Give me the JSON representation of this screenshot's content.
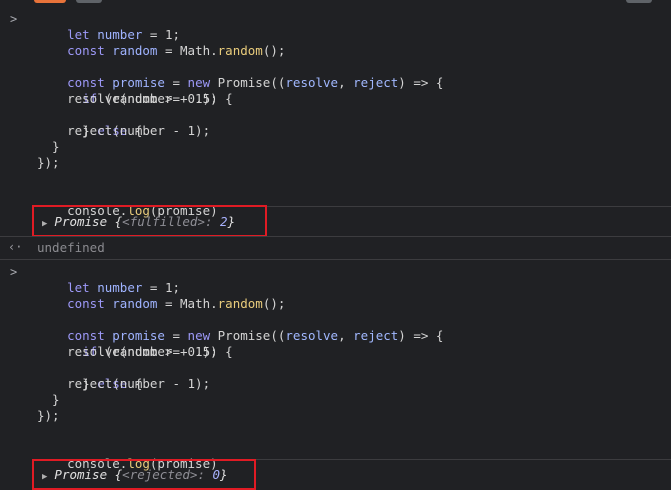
{
  "colors": {
    "background": "#202124",
    "highlight_box": "#e01b24",
    "keyword": "#9d99f8",
    "function": "#e9cc7c"
  },
  "block1": {
    "line1": {
      "a": "let",
      "b": "number",
      "c": " = 1;"
    },
    "line2": {
      "a": "const",
      "b": "random",
      "c": " = Math.",
      "d": "random",
      "e": "();"
    },
    "line4": {
      "a": "const",
      "b": "promise",
      "c": " = ",
      "d": "new",
      "e": " Promise((",
      "f": "resolve",
      "g": ", ",
      "h": "reject",
      "i": ") => {"
    },
    "line5": {
      "a": "  if",
      "b": " (random >= 0.5) {"
    },
    "line6": "    resolve(number + 1);",
    "line7": {
      "a": "  } ",
      "b": "else",
      "c": " {"
    },
    "line8": "    reject(number - 1);",
    "line9": "  }",
    "line10": "});",
    "line12": {
      "a": "console.",
      "b": "log",
      "c": "(promise)"
    },
    "result": {
      "name": "Promise",
      "open": " {",
      "key": "<fulfilled>",
      "colon": ": ",
      "value": "2",
      "close": "}"
    }
  },
  "undefined_output": "undefined",
  "block2": {
    "line1": {
      "a": "let",
      "b": "number",
      "c": " = 1;"
    },
    "line2": {
      "a": "const",
      "b": "random",
      "c": " = Math.",
      "d": "random",
      "e": "();"
    },
    "line4": {
      "a": "const",
      "b": "promise",
      "c": " = ",
      "d": "new",
      "e": " Promise((",
      "f": "resolve",
      "g": ", ",
      "h": "reject",
      "i": ") => {"
    },
    "line5": {
      "a": "  if",
      "b": " (random >= 0.5) {"
    },
    "line6": "    resolve(number + 1);",
    "line7": {
      "a": "  } ",
      "b": "else",
      "c": " {"
    },
    "line8": "    reject(number - 1);",
    "line9": "  }",
    "line10": "});",
    "line12": {
      "a": "console.",
      "b": "log",
      "c": "(promise)"
    },
    "result": {
      "name": "Promise",
      "open": " {",
      "key": "<rejected>",
      "colon": ": ",
      "value": "0",
      "close": "}"
    }
  }
}
